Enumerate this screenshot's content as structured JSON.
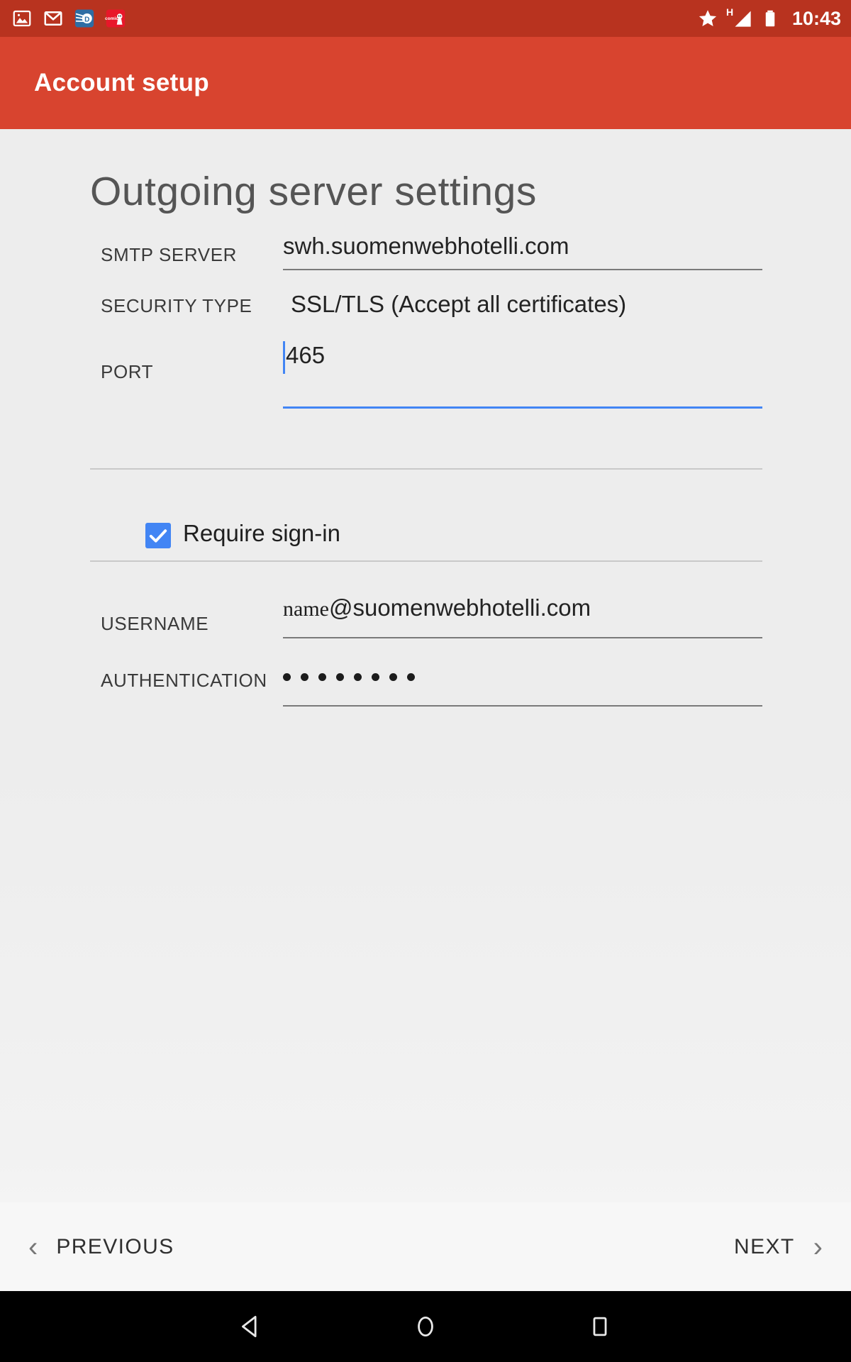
{
  "status_bar": {
    "background": "#b8331f",
    "time": "10:43",
    "left_icons": [
      {
        "name": "screenshot-image-icon",
        "label": "Screenshot"
      },
      {
        "name": "gmail-icon",
        "label": "Gmail"
      },
      {
        "name": "disqus-app-icon",
        "label": "D"
      },
      {
        "name": "comics-app-icon",
        "label": "comics"
      }
    ],
    "right_icons": [
      {
        "name": "priority-star-icon",
        "label": "Priority"
      },
      {
        "name": "signal-icon",
        "label": "H"
      },
      {
        "name": "battery-icon",
        "label": "Battery full"
      }
    ]
  },
  "app_bar": {
    "background": "#d8442f",
    "title": "Account setup"
  },
  "page": {
    "heading": "Outgoing server settings",
    "background": "#ededed",
    "accent": "#4285f4"
  },
  "form": {
    "fields": [
      {
        "name": "smtp-server",
        "label": "SMTP SERVER",
        "value": "swh.suomenwebhotelli.com",
        "type": "text",
        "focused": false
      },
      {
        "name": "security-type",
        "label": "SECURITY TYPE",
        "value": "SSL/TLS (Accept all certificates)",
        "type": "spinner",
        "focused": false
      },
      {
        "name": "port",
        "label": "PORT",
        "value": "465",
        "type": "number",
        "focused": true
      }
    ],
    "require_signin": {
      "label": "Require sign-in",
      "checked": true
    },
    "credentials": [
      {
        "name": "username",
        "label": "USERNAME",
        "value_prefix": "name",
        "value_suffix": "@suomenwebhotelli.com",
        "type": "text",
        "focused": false
      },
      {
        "name": "authentication",
        "label": "AUTHENTICATION",
        "value": "••••••••",
        "dot_count": 8,
        "type": "password",
        "focused": false
      }
    ]
  },
  "buttons": {
    "previous": {
      "label": "PREVIOUS",
      "icon": "chevron-left-icon"
    },
    "next": {
      "label": "NEXT",
      "icon": "chevron-right-icon"
    }
  },
  "system_nav": {
    "background": "#000000",
    "keys": [
      {
        "name": "back-key",
        "label": "Back"
      },
      {
        "name": "home-key",
        "label": "Home"
      },
      {
        "name": "recents-key",
        "label": "Recents"
      }
    ]
  }
}
